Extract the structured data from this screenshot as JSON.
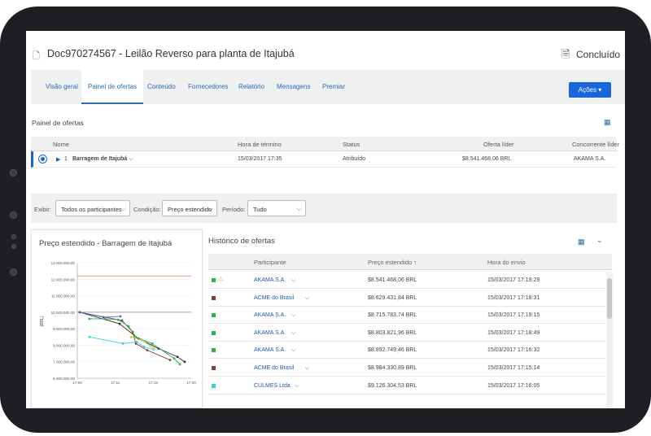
{
  "header": {
    "doc_title": "Doc970274567 - Leilão Reverso para planta de Itajubá",
    "status": "Concluído"
  },
  "tabs": [
    {
      "label": "Visão geral",
      "active": false
    },
    {
      "label": "Painel de ofertas",
      "active": true
    },
    {
      "label": "Conteúdo",
      "active": false
    },
    {
      "label": "Fornecedores",
      "active": false
    },
    {
      "label": "Relatório",
      "active": false
    },
    {
      "label": "Mensagens",
      "active": false
    },
    {
      "label": "Premiar",
      "active": false
    }
  ],
  "actions_button": "Ações ▾",
  "painel": {
    "title": "Painel de ofertas",
    "columns": [
      "Nome",
      "Hora de término",
      "Status",
      "Oferta líder",
      "Concorrente líder"
    ],
    "row": {
      "index": "1",
      "name": "Barragem de Itajubá",
      "end_time": "15/03/2017 17:35",
      "status": "Atribuído",
      "leading_bid": "$8.541.468,06 BRL",
      "leading_competitor": "AKAMA S.A."
    }
  },
  "filters": {
    "exibir_label": "Exibir:",
    "exibir_value": "Todos os participantes",
    "condicao_label": "Condição:",
    "condicao_value": "Preço estendido",
    "periodo_label": "Período:",
    "periodo_value": "Tudo"
  },
  "chart_data": {
    "type": "line",
    "title": "Preço estendido - Barragem de Itajubá",
    "ylabel": "(BRL)",
    "ylim": [
      6000000,
      13000000
    ],
    "xlim_minutes": [
      0,
      14
    ],
    "xticks": [
      "17:06",
      "17:11",
      "17:16",
      "17:20"
    ],
    "yticks": [
      "6.000.000,00",
      "7.000.000,00",
      "8.000.000,00",
      "9.000.000,00",
      "10.000.000,00",
      "11.000.000,00",
      "12.000.000,00",
      "13.000.000,00"
    ],
    "reference_lines": [
      {
        "value": 12200000,
        "color": "#e8795c"
      },
      {
        "value": 10000000,
        "color": "#888888"
      }
    ],
    "series": [
      {
        "color": "#2c2c2c",
        "x": [
          0.3,
          5.2,
          7.5,
          10.0,
          12.3,
          13.2
        ],
        "y": [
          10000000,
          9300000,
          8400000,
          7800000,
          7300000,
          7000000
        ]
      },
      {
        "color": "#8b3a3a",
        "x": [
          0.3,
          5.5,
          6.8,
          7.2,
          8.6,
          11.4
        ],
        "y": [
          10000000,
          9500000,
          8800000,
          8100000,
          7700000,
          7100000
        ]
      },
      {
        "color": "#2fb04a",
        "x": [
          1.5,
          3.4,
          5.0,
          6.3,
          7.2,
          9.2,
          11.9,
          12.6
        ],
        "y": [
          9600000,
          9600000,
          9550000,
          9150000,
          8500000,
          8100000,
          7200000,
          6850000
        ]
      },
      {
        "color": "#3cc8e0",
        "x": [
          1.5,
          5.6,
          7.3,
          8.2,
          9.4
        ],
        "y": [
          8500000,
          8100000,
          8200000,
          7900000,
          7750000
        ]
      },
      {
        "color": "#4a66c8",
        "x": [
          0.3,
          3.2,
          5.3
        ],
        "y": [
          10000000,
          9700000,
          9750000
        ]
      },
      {
        "color": "#c8c85a",
        "x": [
          6.6,
          8.0,
          9.4
        ],
        "y": [
          8500000,
          8300000,
          7800000
        ]
      }
    ]
  },
  "historico": {
    "title": "Histórico de ofertas",
    "columns": [
      "Participante",
      "Preço estendido ↑",
      "Hora do envio"
    ],
    "rows": [
      {
        "color": "#2fb04a",
        "participant": "AKAMA S.A.",
        "price": "$8.541.468,06 BRL",
        "time": "15/03/2017 17:19:29",
        "winner": true
      },
      {
        "color": "#8b3a3a",
        "participant": "ACME do Brasil",
        "price": "$8.629.431,84 BRL",
        "time": "15/03/2017 17:18:31",
        "winner": false
      },
      {
        "color": "#2fb04a",
        "participant": "AKAMA S.A.",
        "price": "$8.715.783,74 BRL",
        "time": "15/03/2017 17:19:15",
        "winner": false
      },
      {
        "color": "#2fb04a",
        "participant": "AKAMA S.A.",
        "price": "$8.803.821,96 BRL",
        "time": "15/03/2017 17:18:49",
        "winner": false
      },
      {
        "color": "#2fb04a",
        "participant": "AKAMA S.A.",
        "price": "$8.892.749,46 BRL",
        "time": "15/03/2017 17:16:32",
        "winner": false
      },
      {
        "color": "#8b3a3a",
        "participant": "ACME do Brasil",
        "price": "$8.984.330,89 BRL",
        "time": "15/03/2017 17:15:14",
        "winner": false
      },
      {
        "color": "#3cc8e0",
        "participant": "CULMES Ltda",
        "price": "$9.126.304,53 BRL",
        "time": "15/03/2017 17:16:05",
        "winner": false
      }
    ]
  }
}
